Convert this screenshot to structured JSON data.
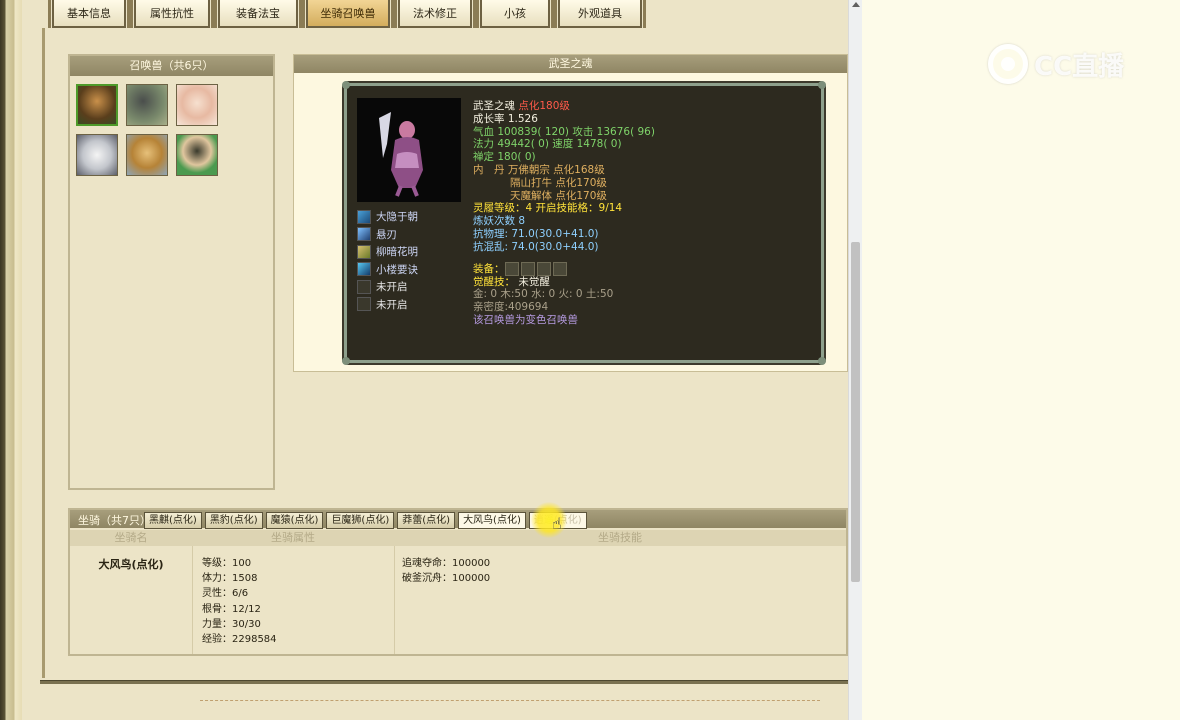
{
  "tabs": [
    {
      "label": "基本信息",
      "active": false
    },
    {
      "label": "属性抗性",
      "active": false
    },
    {
      "label": "装备法宝",
      "active": false
    },
    {
      "label": "坐骑召唤兽",
      "active": true
    },
    {
      "label": "法术修正",
      "active": false
    },
    {
      "label": "小孩",
      "active": false
    },
    {
      "label": "外观道具",
      "active": false
    }
  ],
  "summon_list": {
    "title": "召唤兽（共6只）",
    "avatars": [
      "avatar-1",
      "avatar-2",
      "avatar-3",
      "avatar-4",
      "avatar-5",
      "avatar-6"
    ]
  },
  "pet": {
    "header": "武圣之魂",
    "name": "武圣之魂",
    "level_tag": "点化180级",
    "growth": "成长率 1.526",
    "hp_line": "气血 100839( 120) 攻击 13676( 96)",
    "mp_line": "法力 49442( 0) 速度 1478( 0)",
    "def_line": "禅定 180( 0)",
    "neidan_1": "内　丹 万佛朝宗 点化168级",
    "neidan_2": "隔山打牛 点化170级",
    "neidan_3": "天魔解体 点化170级",
    "spirit_line": "灵履等级：4 开启技能格：9/14",
    "refine_line": "炼妖次数 8",
    "phys_res": "抗物理: 71.0(30.0+41.0)",
    "chaos_res": "抗混乱: 74.0(30.0+44.0)",
    "equip_label": "装备：",
    "awaken_label": "觉醒技：",
    "awaken_value": "未觉醒",
    "elements": "金: 0 木:50 水: 0 火: 0 土:50",
    "intimacy": "亲密度:409694",
    "variant_note": "该召唤兽为变色召唤兽",
    "skills": [
      {
        "name": "大隐于朝",
        "locked": false
      },
      {
        "name": "悬刃",
        "locked": false
      },
      {
        "name": "柳暗花明",
        "locked": false
      },
      {
        "name": "小楼要诀",
        "locked": false
      },
      {
        "name": "未开启",
        "locked": true
      },
      {
        "name": "未开启",
        "locked": true
      }
    ]
  },
  "mount": {
    "title": "坐骑（共7只）",
    "tabs": [
      {
        "label": "黑麒(点化)"
      },
      {
        "label": "黑豹(点化)"
      },
      {
        "label": "魔猿(点化)"
      },
      {
        "label": "巨魔狮(点化)"
      },
      {
        "label": "莽蕾(点化)"
      },
      {
        "label": "大风鸟(点化)",
        "active": true
      },
      {
        "label": "逍遥(点化)",
        "hover": true
      }
    ],
    "col_name": "坐骑名",
    "col_attr": "坐骑属性",
    "col_skill": "坐骑技能",
    "name": "大风鸟(点化)",
    "attrs": [
      "等级：100",
      "体力：1508",
      "灵性：6/6",
      "根骨：12/12",
      "力量：30/30",
      "经验：2298584"
    ],
    "skills": [
      "追魂夺命：100000",
      "破釜沉舟：100000"
    ]
  },
  "watermark": {
    "text": "CC直播"
  }
}
